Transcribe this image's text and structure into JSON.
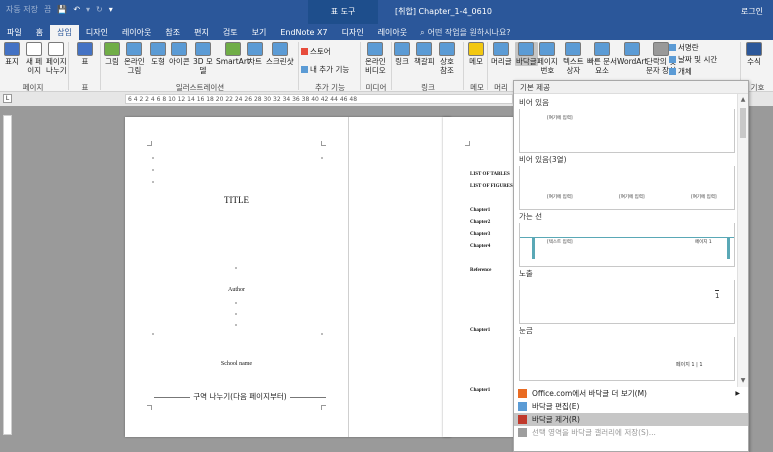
{
  "titlebar": {
    "autosave": "자동 저장",
    "autosave_state": "끔",
    "context_tab_group": "표 도구",
    "document_title": "[취합] Chapter_1-4_0610",
    "login": "로그인"
  },
  "tabs": [
    {
      "label": "파일",
      "active": false
    },
    {
      "label": "홈",
      "active": false
    },
    {
      "label": "삽입",
      "active": true
    },
    {
      "label": "디자인",
      "active": false
    },
    {
      "label": "레이아웃",
      "active": false
    },
    {
      "label": "참조",
      "active": false
    },
    {
      "label": "편지",
      "active": false
    },
    {
      "label": "검토",
      "active": false
    },
    {
      "label": "보기",
      "active": false
    },
    {
      "label": "EndNote X7",
      "active": false
    },
    {
      "label": "디자인",
      "active": false
    },
    {
      "label": "레이아웃",
      "active": false
    }
  ],
  "tell_me": "어떤 작업을 원하시나요?",
  "ribbon": {
    "buttons": [
      {
        "label": "표지",
        "sub": "",
        "icon": "cover-page-icon",
        "color": "#4472c4"
      },
      {
        "label": "새 페",
        "sub": "이지",
        "icon": "blank-page-icon",
        "color": "#ffffff"
      },
      {
        "label": "페이지",
        "sub": "나누기",
        "icon": "page-break-icon",
        "color": "#ffffff"
      },
      {
        "label": "표",
        "sub": "",
        "icon": "table-icon",
        "color": "#4472c4"
      },
      {
        "label": "그림",
        "sub": "",
        "icon": "picture-icon",
        "color": "#70ad47"
      },
      {
        "label": "온라인",
        "sub": "그림",
        "icon": "online-picture-icon",
        "color": "#5b9bd5"
      },
      {
        "label": "도형",
        "sub": "",
        "icon": "shapes-icon",
        "color": "#5b9bd5"
      },
      {
        "label": "아이콘",
        "sub": "",
        "icon": "icons-icon",
        "color": "#5b9bd5"
      },
      {
        "label": "3D 모",
        "sub": "델",
        "icon": "3d-model-icon",
        "color": "#5b9bd5"
      },
      {
        "label": "SmartArt",
        "sub": "",
        "icon": "smartart-icon",
        "color": "#70ad47"
      },
      {
        "label": "차트",
        "sub": "",
        "icon": "chart-icon",
        "color": "#5b9bd5"
      },
      {
        "label": "스크린샷",
        "sub": "",
        "icon": "screenshot-icon",
        "color": "#5b9bd5"
      },
      {
        "label": "온라인",
        "sub": "비디오",
        "icon": "online-video-icon",
        "color": "#5b9bd5"
      },
      {
        "label": "링크",
        "sub": "",
        "icon": "link-icon",
        "color": "#5b9bd5"
      },
      {
        "label": "책갈피",
        "sub": "",
        "icon": "bookmark-icon",
        "color": "#5b9bd5"
      },
      {
        "label": "상호",
        "sub": "참조",
        "icon": "cross-reference-icon",
        "color": "#5b9bd5"
      },
      {
        "label": "메모",
        "sub": "",
        "icon": "comment-icon",
        "color": "#f2c811"
      },
      {
        "label": "머리글",
        "sub": "",
        "icon": "header-icon",
        "color": "#5b9bd5"
      },
      {
        "label": "바닥글",
        "sub": "",
        "icon": "footer-icon",
        "color": "#5b9bd5"
      },
      {
        "label": "페이지",
        "sub": "번호",
        "icon": "page-number-icon",
        "color": "#5b9bd5"
      },
      {
        "label": "텍스트",
        "sub": "상자",
        "icon": "text-box-icon",
        "color": "#5b9bd5"
      },
      {
        "label": "빠른 문서",
        "sub": "요소",
        "icon": "quick-parts-icon",
        "color": "#5b9bd5"
      },
      {
        "label": "WordArt",
        "sub": "",
        "icon": "wordart-icon",
        "color": "#5b9bd5"
      },
      {
        "label": "단락의 첫",
        "sub": "문자 장식",
        "icon": "drop-cap-icon",
        "color": "#999999"
      },
      {
        "label": "수식",
        "sub": "",
        "icon": "equation-icon",
        "color": "#2b579a"
      }
    ],
    "store": "스토어",
    "my_addins": "내 추가 기능",
    "signature": "서명란",
    "datetime": "날짜 및 시간",
    "object": "개체",
    "groups": [
      "페이지",
      "표",
      "일러스트레이션",
      "추가 기능",
      "미디어",
      "링크",
      "메모",
      "머리",
      "기호"
    ]
  },
  "ruler": {
    "marks": "6 4 2 2 4 6 8 10 12 14 16 18 20 22 24 26 28 30 32 34 36 38 40 42 44 46 48",
    "corner": "L"
  },
  "page1": {
    "title": "TITLE",
    "author": "Author",
    "school": "School name",
    "section_break": "구역 나누기(다음 페이지부터)"
  },
  "page2": {
    "lines": [
      "LIST OF TABLES",
      "LIST OF FIGURES",
      "Chapter1",
      "Chapter2",
      "Chapter3",
      "Chapter4",
      "Reference",
      "Chapter1",
      "Chapter1"
    ]
  },
  "gallery": {
    "header": "기본 제공",
    "items": [
      {
        "title": "비어 있음",
        "placeholders": [
          "[여기에 입력]"
        ]
      },
      {
        "title": "비어 있음(3열)",
        "placeholders": [
          "[여기에 입력]",
          "[여기에 입력]",
          "[여기에 입력]"
        ]
      },
      {
        "title": "가는 선",
        "placeholders": [
          "[텍스트 입력]",
          "페이지 1"
        ]
      },
      {
        "title": "노출",
        "placeholders": [
          "1"
        ]
      },
      {
        "title": "눈금",
        "placeholders": [
          "페이지 1 | 1"
        ]
      }
    ],
    "menu": [
      {
        "label": "Office.com에서 바닥글 더 보기(M)",
        "icon": "office-icon",
        "arrow": "▶",
        "highlight": false,
        "disabled": false
      },
      {
        "label": "바닥글 편집(E)",
        "icon": "edit-footer-icon",
        "arrow": "",
        "highlight": false,
        "disabled": false
      },
      {
        "label": "바닥글 제거(R)",
        "icon": "remove-footer-icon",
        "arrow": "",
        "highlight": true,
        "disabled": false
      },
      {
        "label": "선택 영역을 바닥글 갤러리에 저장(S)...",
        "icon": "save-selection-icon",
        "arrow": "",
        "highlight": false,
        "disabled": true
      }
    ]
  },
  "colors": {
    "brand": "#2b579a",
    "ribbon_bg": "#f3f3f3",
    "canvas": "#9a9a9a",
    "accent_teal": "#5aa8b6"
  }
}
